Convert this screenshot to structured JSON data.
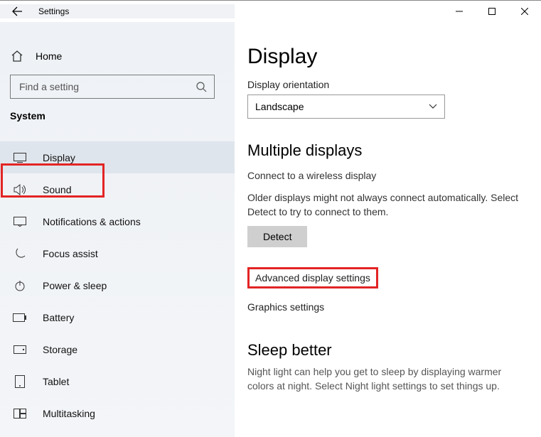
{
  "window": {
    "title": "Settings"
  },
  "sidebar": {
    "home_label": "Home",
    "search_placeholder": "Find a setting",
    "group_label": "System",
    "items": [
      {
        "label": "Display"
      },
      {
        "label": "Sound"
      },
      {
        "label": "Notifications & actions"
      },
      {
        "label": "Focus assist"
      },
      {
        "label": "Power & sleep"
      },
      {
        "label": "Battery"
      },
      {
        "label": "Storage"
      },
      {
        "label": "Tablet"
      },
      {
        "label": "Multitasking"
      }
    ]
  },
  "content": {
    "page_title": "Display",
    "orientation_label": "Display orientation",
    "orientation_value": "Landscape",
    "multiple_title": "Multiple displays",
    "wireless_link": "Connect to a wireless display",
    "detect_help": "Older displays might not always connect automatically. Select Detect to try to connect to them.",
    "detect_button": "Detect",
    "adv_link": "Advanced display settings",
    "graphics_link": "Graphics settings",
    "sleep_title": "Sleep better",
    "sleep_help": "Night light can help you get to sleep by displaying warmer colors at night. Select Night light settings to set things up."
  }
}
